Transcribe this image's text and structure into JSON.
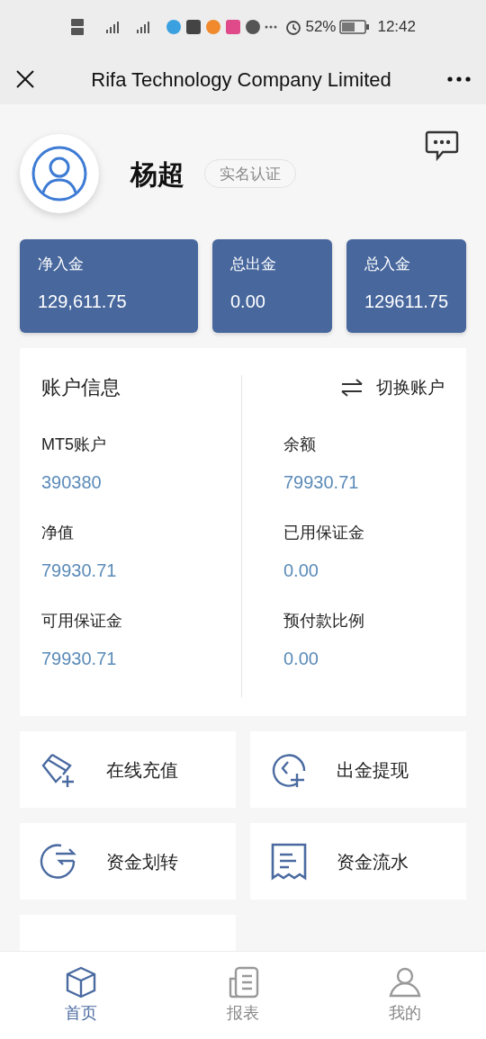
{
  "status_bar": {
    "battery": "52%",
    "time": "12:42"
  },
  "header": {
    "title": "Rifa Technology Company Limited"
  },
  "profile": {
    "name": "杨超",
    "badge": "实名认证"
  },
  "stats": [
    {
      "label": "净入金",
      "value": "129,611.75"
    },
    {
      "label": "总出金",
      "value": "0.00"
    },
    {
      "label": "总入金",
      "value": "129611.75"
    }
  ],
  "account": {
    "title": "账户信息",
    "switch_label": "切换账户",
    "fields": [
      {
        "label": "MT5账户",
        "value": "390380"
      },
      {
        "label": "余额",
        "value": "79930.71"
      },
      {
        "label": "净值",
        "value": "79930.71"
      },
      {
        "label": "已用保证金",
        "value": "0.00"
      },
      {
        "label": "可用保证金",
        "value": "79930.71"
      },
      {
        "label": "预付款比例",
        "value": "0.00"
      }
    ]
  },
  "actions": [
    {
      "kind": "card",
      "label": "在线充值"
    },
    {
      "kind": "withdraw",
      "label": "出金提现"
    },
    {
      "kind": "transfer",
      "label": "资金划转"
    },
    {
      "kind": "receipt",
      "label": "资金流水"
    }
  ],
  "tabs": [
    {
      "kind": "home",
      "label": "首页",
      "selected": true
    },
    {
      "kind": "report",
      "label": "报表",
      "selected": false
    },
    {
      "kind": "me",
      "label": "我的",
      "selected": false
    }
  ]
}
